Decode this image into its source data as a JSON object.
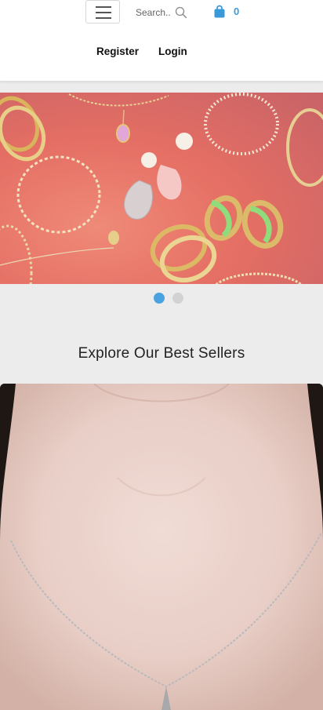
{
  "header": {
    "search_placeholder": "Search..",
    "cart_count": "0",
    "register_label": "Register",
    "login_label": "Login"
  },
  "icons": {
    "menu": "hamburger-menu-icon",
    "search": "search-icon",
    "cart": "shopping-bag-icon"
  },
  "carousel": {
    "slide_count": 2,
    "active_slide": 1
  },
  "bestsellers": {
    "title": "Explore Our Best Sellers"
  },
  "colors": {
    "accent": "#3a9ad9",
    "dot_active": "#4aa3e0",
    "dot_inactive": "#d2d2d2",
    "page_bg": "#ececec"
  }
}
